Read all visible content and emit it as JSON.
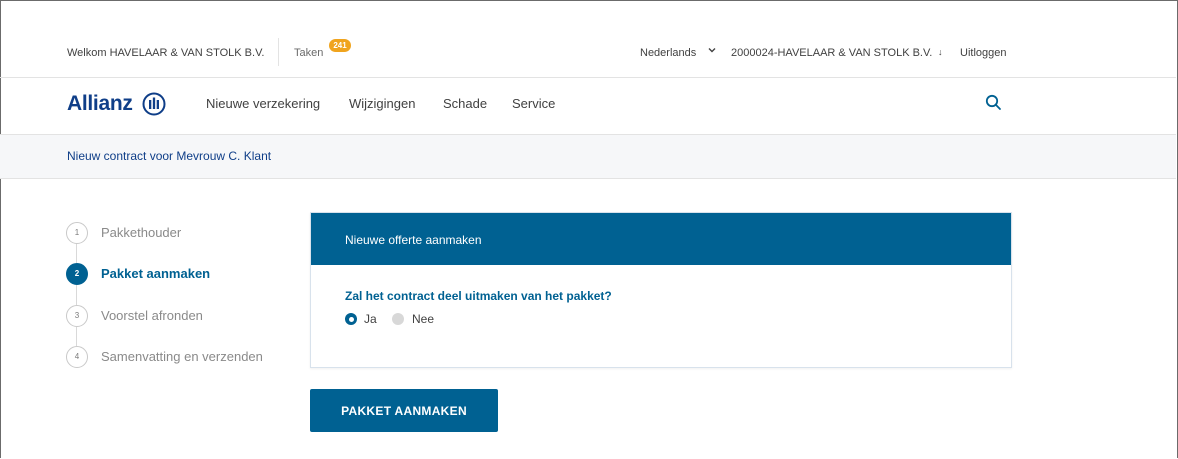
{
  "topbar": {
    "welcome": "Welkom HAVELAAR & VAN STOLK B.V.",
    "tasks_label": "Taken",
    "tasks_count": "241",
    "language": "Nederlands",
    "account": "2000024-HAVELAAR & VAN STOLK B.V.",
    "logout": "Uitloggen"
  },
  "nav": {
    "brand": "Allianz",
    "items": [
      "Nieuwe verzekering",
      "Wijzigingen",
      "Schade",
      "Service"
    ]
  },
  "breadcrumb": "Nieuw contract voor Mevrouw C. Klant",
  "steps": [
    {
      "number": "1",
      "label": "Pakkethouder",
      "state": "inactive"
    },
    {
      "number": "2",
      "label": "Pakket aanmaken",
      "state": "active"
    },
    {
      "number": "3",
      "label": "Voorstel afronden",
      "state": "inactive"
    },
    {
      "number": "4",
      "label": "Samenvatting en verzenden",
      "state": "inactive"
    }
  ],
  "card": {
    "title": "Nieuwe offerte aanmaken",
    "question": "Zal het contract deel uitmaken van het pakket?",
    "options": [
      {
        "label": "Ja",
        "checked": true
      },
      {
        "label": "Nee",
        "checked": false
      }
    ]
  },
  "primary_button": "PAKKET AANMAKEN",
  "colors": {
    "brand_blue": "#0f3e88",
    "accent_blue": "#006192",
    "badge_orange": "#f0a41e"
  },
  "icons": {
    "language": "chevron-down-icon",
    "account": "arrow-down-icon",
    "brand": "allianz-eagle-logo",
    "search": "search-icon"
  }
}
